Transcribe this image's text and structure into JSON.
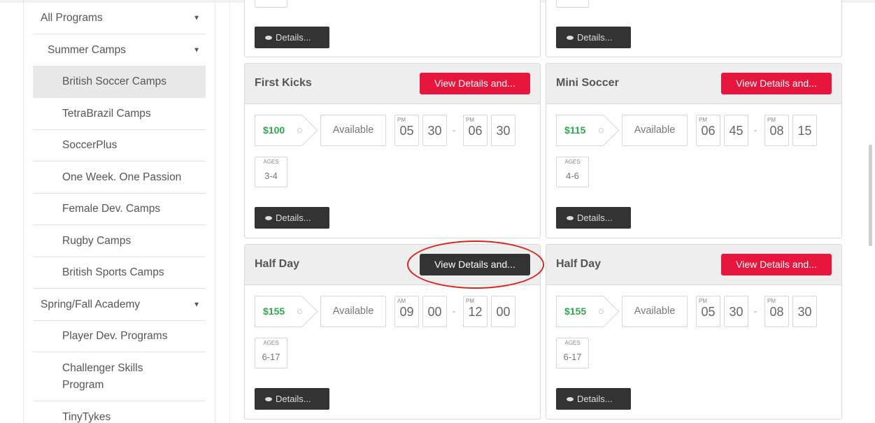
{
  "sidebar": {
    "items": [
      {
        "label": "All Programs",
        "caret": "▼"
      },
      {
        "label": "Summer Camps",
        "caret": "▼"
      },
      {
        "label": "British Soccer Camps"
      },
      {
        "label": "TetraBrazil Camps"
      },
      {
        "label": "SoccerPlus"
      },
      {
        "label": "One Week. One Passion"
      },
      {
        "label": "Female Dev. Camps"
      },
      {
        "label": "Rugby Camps"
      },
      {
        "label": "British Sports Camps"
      },
      {
        "label": "Spring/Fall Academy",
        "caret": "▼"
      },
      {
        "label": "Player Dev. Programs"
      },
      {
        "label": "Challenger Skills Program"
      },
      {
        "label": "TinyTykes"
      }
    ]
  },
  "cards": [
    {
      "details_label": "Details..."
    },
    {
      "details_label": "Details..."
    },
    {
      "title": "First Kicks",
      "view_label": "View Details and...",
      "price": "$100",
      "availability": "Available",
      "start": {
        "ampm": "PM",
        "hour": "05",
        "min": "30"
      },
      "end": {
        "ampm": "PM",
        "hour": "06",
        "min": "30"
      },
      "ages_label": "AGES",
      "ages": "3-4",
      "details_label": "Details..."
    },
    {
      "title": "Mini Soccer",
      "view_label": "View Details and...",
      "price": "$115",
      "availability": "Available",
      "start": {
        "ampm": "PM",
        "hour": "06",
        "min": "45"
      },
      "end": {
        "ampm": "PM",
        "hour": "08",
        "min": "15"
      },
      "ages_label": "AGES",
      "ages": "4-6",
      "details_label": "Details..."
    },
    {
      "title": "Half Day",
      "view_label": "View Details and...",
      "price": "$155",
      "availability": "Available",
      "start": {
        "ampm": "AM",
        "hour": "09",
        "min": "00"
      },
      "end": {
        "ampm": "PM",
        "hour": "12",
        "min": "00"
      },
      "ages_label": "AGES",
      "ages": "6-17",
      "details_label": "Details..."
    },
    {
      "title": "Half Day",
      "view_label": "View Details and...",
      "price": "$155",
      "availability": "Available",
      "start": {
        "ampm": "PM",
        "hour": "05",
        "min": "30"
      },
      "end": {
        "ampm": "PM",
        "hour": "08",
        "min": "30"
      },
      "ages_label": "AGES",
      "ages": "6-17",
      "details_label": "Details..."
    }
  ],
  "time_separator": "-",
  "colors": {
    "accent_red": "#e8163c",
    "price_green": "#2fa84f",
    "dark_button": "#333333",
    "annotation_circle": "#d9241d"
  }
}
